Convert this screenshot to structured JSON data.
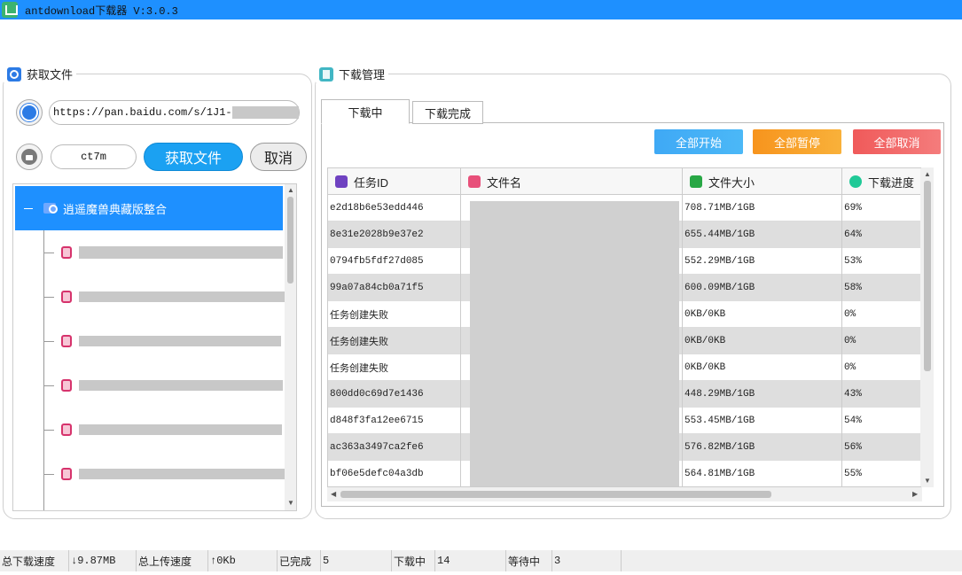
{
  "window": {
    "title": "antdownload下载器  V:3.0.3"
  },
  "left": {
    "group_title": "获取文件",
    "url_value": "https://pan.baidu.com/s/1J1-",
    "code_value": "ct7m",
    "fetch_button": "获取文件",
    "cancel_button": "取消",
    "tree_root": "逍遥魔兽典藏版整合",
    "tree_items_count_label": ""
  },
  "right": {
    "group_title": "下载管理",
    "tabs": [
      "下载中",
      "下载完成"
    ],
    "actions": {
      "start_all": "全部开始",
      "pause_all": "全部暂停",
      "cancel_all": "全部取消"
    },
    "colors": {
      "start": "#3fa9f5",
      "pause": "#f7941d",
      "cancel": "#f05a5a"
    },
    "columns": [
      "任务ID",
      "文件名",
      "文件大小",
      "下载进度"
    ],
    "rows": [
      {
        "id": "e2d18b6e53edd446",
        "size": "708.71MB/1GB",
        "progress": "69%"
      },
      {
        "id": "8e31e2028b9e37e2",
        "size": "655.44MB/1GB",
        "progress": "64%"
      },
      {
        "id": "0794fb5fdf27d085",
        "size": "552.29MB/1GB",
        "progress": "53%"
      },
      {
        "id": "99a07a84cb0a71f5",
        "size": "600.09MB/1GB",
        "progress": "58%"
      },
      {
        "id": "任务创建失败",
        "size": "0KB/0KB",
        "progress": "0%"
      },
      {
        "id": "任务创建失败",
        "size": "0KB/0KB",
        "progress": "0%"
      },
      {
        "id": "任务创建失败",
        "size": "0KB/0KB",
        "progress": "0%"
      },
      {
        "id": "800dd0c69d7e1436",
        "size": "448.29MB/1GB",
        "progress": "43%"
      },
      {
        "id": "d848f3fa12ee6715",
        "size": "553.45MB/1GB",
        "progress": "54%"
      },
      {
        "id": "ac363a3497ca2fe6",
        "size": "576.82MB/1GB",
        "progress": "56%"
      },
      {
        "id": "bf06e5defc04a3db",
        "size": "564.81MB/1GB",
        "progress": "55%"
      }
    ]
  },
  "status": {
    "dl_speed_label": "总下载速度",
    "dl_speed": "↓9.87MB",
    "ul_speed_label": "总上传速度",
    "ul_speed": "↑0Kb",
    "done_label": "已完成",
    "done": "5",
    "downloading_label": "下载中",
    "downloading": "14",
    "waiting_label": "等待中",
    "waiting": "3"
  }
}
